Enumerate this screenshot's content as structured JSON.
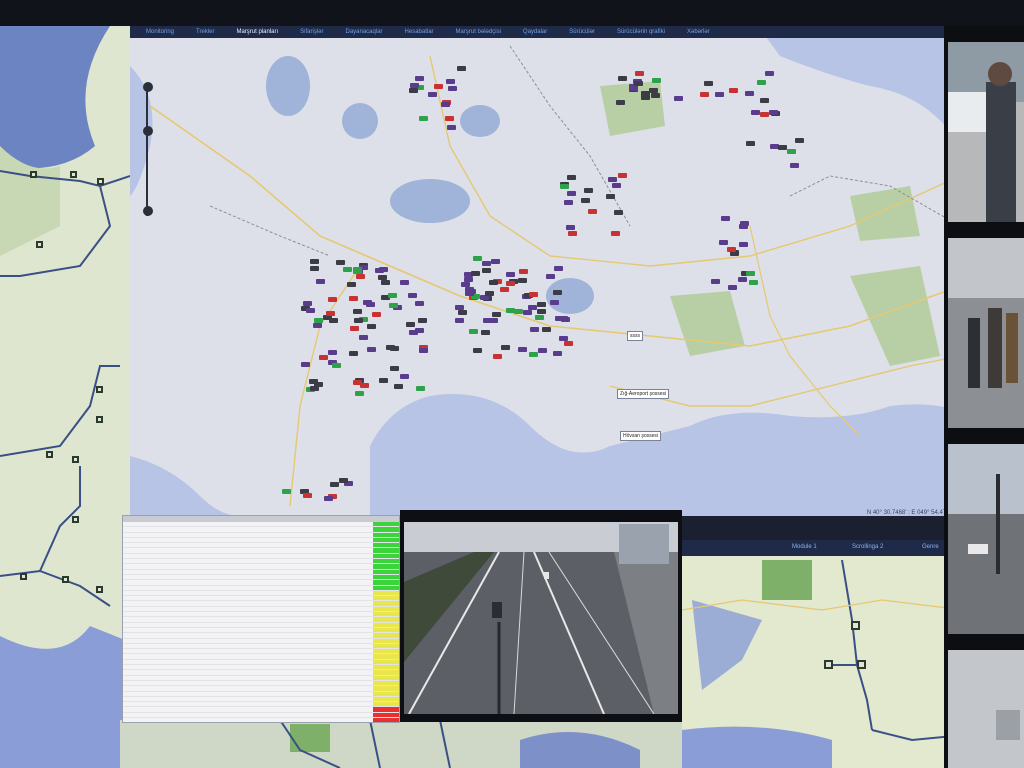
{
  "main_map": {
    "menu_items": [
      "Monitoring",
      "Trekler",
      "Marşrut planları",
      "Sifarişlər",
      "Dayanacaqlar",
      "Hesabatlar",
      "Marşrut bələdçisi",
      "Qaydalar",
      "Sürücülər",
      "Sürücülərin qrafiki",
      "Xəbərlər"
    ],
    "active_menu_index": 2,
    "labels": {
      "highway_1": "Zığ-Aeroport şossesi",
      "highway_2": "Hövsan şossesi",
      "small": "ssss"
    },
    "coordinates": "N 40° 30.7468' : E 049° 54.4778'",
    "colors": {
      "sea": "#b7c4e6",
      "land": "#dde0e8",
      "park": "#b8cfa6",
      "vehicle_purple": "#5a3c8c",
      "vehicle_dark": "#3c3c46",
      "vehicle_red": "#c83232",
      "vehicle_green": "#2ea24a",
      "route_line": "#3a4f86"
    }
  },
  "right_map": {
    "toolbar": [
      "Modulе 1",
      "Scrollingа 2",
      "Genre"
    ]
  },
  "camera_feed": {
    "status": "live"
  },
  "status_table": {
    "row_count": 38,
    "status_colors": [
      "#3bd43b",
      "#e8e64a",
      "#e83030"
    ]
  }
}
